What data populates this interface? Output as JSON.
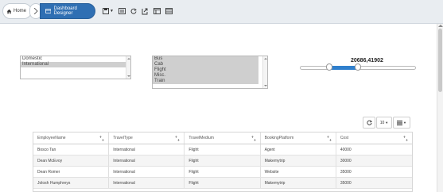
{
  "breadcrumb": {
    "home": "Home",
    "active": "Dashboard Designer"
  },
  "toolbar": {
    "icons": [
      "save-icon",
      "filter-icon",
      "refresh-icon",
      "export-icon",
      "grid-icon",
      "layout-icon"
    ]
  },
  "filters": {
    "travel_type": {
      "items": [
        {
          "label": "Domestic",
          "selected": false
        },
        {
          "label": "International",
          "selected": true
        }
      ]
    },
    "travel_medium": {
      "items": [
        {
          "label": "Bus",
          "selected": true
        },
        {
          "label": "Cab",
          "selected": true
        },
        {
          "label": "Flight",
          "selected": true
        },
        {
          "label": "Misc.",
          "selected": true
        },
        {
          "label": "Train",
          "selected": true
        }
      ]
    },
    "range": {
      "value_label": "20686,41902",
      "low_fraction": 0.25,
      "high_fraction": 0.5
    }
  },
  "grid_toolbar": {
    "page_size": "10"
  },
  "table": {
    "columns": [
      "EmployeeName",
      "TravelType",
      "TravelMedium",
      "BookingPlatform",
      "Cost"
    ],
    "rows": [
      [
        "Bosco Tan",
        "International",
        "Flight",
        "Agent",
        "40000"
      ],
      [
        "Dean McEvoy",
        "International",
        "Flight",
        "Makemytrip",
        "30000"
      ],
      [
        "Dean Romer",
        "International",
        "Flight",
        "Website",
        "35000"
      ],
      [
        "Jolosh Humphreys",
        "International",
        "Flight",
        "Makemytrip",
        "35000"
      ]
    ]
  },
  "colors": {
    "accent": "#2f6fb3",
    "slider_fill": "#2f7fcd",
    "selection": "#cfcfcf"
  }
}
